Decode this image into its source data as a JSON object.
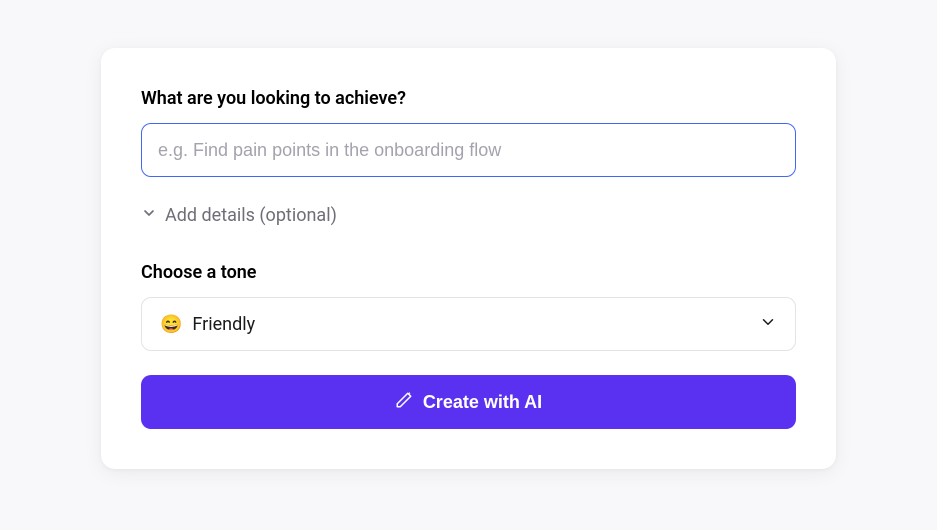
{
  "goal": {
    "label": "What are you looking to achieve?",
    "placeholder": "e.g. Find pain points in the onboarding flow",
    "value": ""
  },
  "details": {
    "toggle_label": "Add details (optional)"
  },
  "tone": {
    "label": "Choose a tone",
    "selected_emoji": "😄",
    "selected_label": "Friendly"
  },
  "actions": {
    "create_label": "Create with AI"
  },
  "colors": {
    "primary": "#5a31f0",
    "input_border_focus": "#4267f6"
  }
}
